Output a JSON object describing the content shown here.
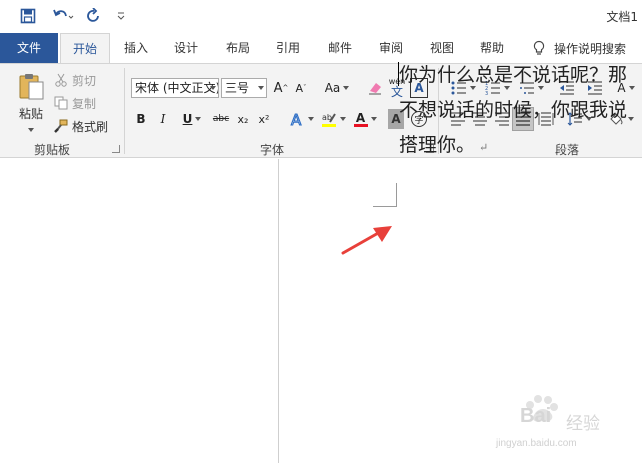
{
  "window": {
    "title": "文档1"
  },
  "quick_access": {
    "save_icon": "save-icon",
    "undo_icon": "undo-icon",
    "redo_icon": "redo-icon",
    "customize_icon": "customize-qat-icon"
  },
  "tabs": [
    {
      "id": "file",
      "label": "文件"
    },
    {
      "id": "home",
      "label": "开始"
    },
    {
      "id": "insert",
      "label": "插入"
    },
    {
      "id": "design",
      "label": "设计"
    },
    {
      "id": "layout",
      "label": "布局"
    },
    {
      "id": "references",
      "label": "引用"
    },
    {
      "id": "mailings",
      "label": "邮件"
    },
    {
      "id": "review",
      "label": "审阅"
    },
    {
      "id": "view",
      "label": "视图"
    },
    {
      "id": "help",
      "label": "帮助"
    }
  ],
  "tell_me": {
    "label": "操作说明搜索"
  },
  "clipboard": {
    "paste": "粘贴",
    "cut": "剪切",
    "copy": "复制",
    "format_painter": "格式刷",
    "group_label": "剪贴板"
  },
  "font": {
    "font_name": "宋体 (中文正文)",
    "font_size": "三号",
    "bold": "B",
    "italic": "I",
    "underline": "U",
    "strike": "abc",
    "subscript": "x₂",
    "superscript": "x²",
    "change_case": "Aa",
    "phonetic_top": "wén",
    "phonetic_bottom": "文",
    "char_border": "A",
    "font_color_letter": "A",
    "shading_letter": "A",
    "enclose_char": "字",
    "group_label": "字体"
  },
  "paragraph": {
    "group_label": "段落"
  },
  "document": {
    "lines": [
      "你为什么总是不说话呢？那",
      "不想说话的时候，你跟我说",
      "搭理你。"
    ],
    "paragraph_mark": "↵"
  },
  "watermark": {
    "brand": "Bai",
    "cn": "经验",
    "url": "jingyan.baidu.com"
  },
  "colors": {
    "accent": "#2b579a",
    "font_color": "#e81123",
    "annotation": "#e8403a"
  }
}
